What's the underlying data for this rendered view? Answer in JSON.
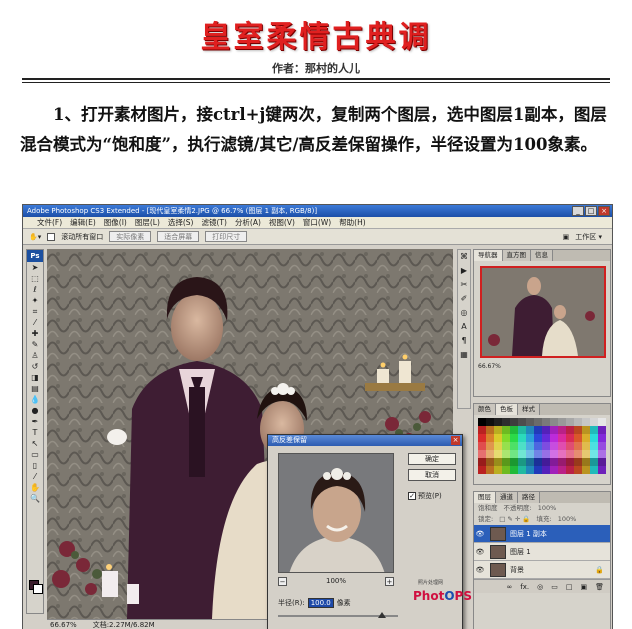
{
  "article": {
    "title": "皇室柔情古典调",
    "author": "作者：那村的人儿",
    "intro": "1、打开素材图片，接ctrl+j键两次，复制两个图层，选中图层1副本，图层混合模式为“饱和度”，执行滤镜/其它/高反差保留操作，半径设置为100象素。"
  },
  "ps": {
    "window_title": "Adobe Photoshop CS3 Extended - [现代皇室柔情2.JPG @ 66.7% (图层 1 副本, RGB/8)]",
    "window_buttons": [
      "_",
      "□",
      "×"
    ],
    "menu": [
      "文件(F)",
      "编辑(E)",
      "图像(I)",
      "图层(L)",
      "选择(S)",
      "滤镜(T)",
      "分析(A)",
      "视图(V)",
      "窗口(W)",
      "帮助(H)"
    ],
    "options": {
      "scroll_all": "滚动所有窗口",
      "buttons": [
        "实际像素",
        "适合屏幕",
        "打印尺寸"
      ],
      "workspace": "工作区 ▾"
    },
    "toolbox_logo": "Ps",
    "status": {
      "zoom": "66.67%",
      "doc": "文档:2.27M/6.82M"
    },
    "dialog": {
      "title": "高反差保留",
      "ok": "确定",
      "cancel": "取消",
      "preview": "预览(P)",
      "zoom": "100%",
      "radius_label": "半径(R):",
      "radius_value": "100.0",
      "radius_unit": "像素"
    },
    "watermark": {
      "small": "照片处理网",
      "brand_a": "Phot",
      "brand_o": "O",
      "brand_b": "PS"
    },
    "navigator": {
      "tabs": [
        "导航器",
        "直方图",
        "信息"
      ],
      "zoom": "66.67%"
    },
    "color": {
      "tabs": [
        "颜色",
        "色板",
        "样式"
      ]
    },
    "layers": {
      "tabs": [
        "图层",
        "通道",
        "路径"
      ],
      "mode": "饱和度",
      "opacity_label": "不透明度:",
      "opacity": "100%",
      "lock_label": "锁定:",
      "fill_label": "填充:",
      "fill": "100%",
      "items": [
        {
          "name": "图层 1 副本",
          "selected": true
        },
        {
          "name": "图层 1",
          "selected": false
        },
        {
          "name": "背景",
          "selected": false,
          "locked": true
        }
      ],
      "footer": [
        "∞",
        "fx.",
        "◎",
        "▭",
        "□",
        "▣",
        "🗑"
      ]
    }
  }
}
